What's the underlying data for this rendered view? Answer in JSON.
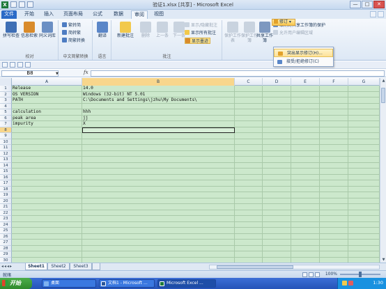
{
  "window": {
    "app_icon": "X",
    "title": "验证1.xlsx  [共享] - Microsoft Excel",
    "controls": [
      "—",
      "□",
      "✕"
    ]
  },
  "ribbon_tabs": [
    "文件",
    "开始",
    "插入",
    "页面布局",
    "公式",
    "数据",
    "审阅",
    "视图"
  ],
  "active_tab": "审阅",
  "ribbon": {
    "proofing": {
      "label": "校对",
      "buttons": [
        "拼写检查",
        "信息检索",
        "同义词库"
      ]
    },
    "chinese_conversion": {
      "label": "中文简繁转换",
      "buttons": [
        "繁转简",
        "简转繁",
        "简繁转换"
      ]
    },
    "language": {
      "label": "语言",
      "buttons": [
        "翻译"
      ]
    },
    "comments": {
      "label": "批注",
      "buttons": [
        "新建批注",
        "删除",
        "上一条",
        "下一条"
      ],
      "small_buttons": [
        "显示/隐藏批注",
        "显示所有批注",
        "显示墨迹"
      ]
    },
    "changes": {
      "buttons": [
        "保护工作表",
        "保护工作簿",
        "共享工作簿"
      ],
      "small_buttons": [
        "取消对共享工作簿的保护",
        "允许用户编辑区域"
      ],
      "revise_label": "修订"
    }
  },
  "revise_menu": {
    "items": [
      "突出显示修订(H)...",
      "接受/拒绝修订(C)"
    ],
    "hovered_index": 0
  },
  "formula_bar": {
    "name_box": "B8",
    "fx": "fx",
    "content": ""
  },
  "columns": [
    "A",
    "B",
    "C",
    "D",
    "E",
    "F",
    "G"
  ],
  "rows": [
    {
      "num": "1",
      "A": "Release",
      "B": "14.0"
    },
    {
      "num": "2",
      "A": "OS VERSION",
      "B": "Windows (32-bit) NT 5.01"
    },
    {
      "num": "3",
      "A": "PATH",
      "B": "C:\\Documents and Settings\\jzhu\\My Documents\\"
    },
    {
      "num": "4",
      "A": "",
      "B": ""
    },
    {
      "num": "5",
      "A": "calculation",
      "B": "hhh"
    },
    {
      "num": "6",
      "A": "peak area",
      "B": "jj"
    },
    {
      "num": "7",
      "A": "impurity",
      "B": "X"
    },
    {
      "num": "8",
      "A": "",
      "B": ""
    },
    {
      "num": "9",
      "A": "",
      "B": ""
    },
    {
      "num": "10",
      "A": "",
      "B": ""
    },
    {
      "num": "11",
      "A": "",
      "B": ""
    },
    {
      "num": "12",
      "A": "",
      "B": ""
    },
    {
      "num": "13",
      "A": "",
      "B": ""
    },
    {
      "num": "14",
      "A": "",
      "B": ""
    },
    {
      "num": "15",
      "A": "",
      "B": ""
    },
    {
      "num": "16",
      "A": "",
      "B": ""
    },
    {
      "num": "17",
      "A": "",
      "B": ""
    },
    {
      "num": "18",
      "A": "",
      "B": ""
    },
    {
      "num": "19",
      "A": "",
      "B": ""
    },
    {
      "num": "20",
      "A": "",
      "B": ""
    },
    {
      "num": "21",
      "A": "",
      "B": ""
    },
    {
      "num": "22",
      "A": "",
      "B": ""
    },
    {
      "num": "23",
      "A": "",
      "B": ""
    },
    {
      "num": "24",
      "A": "",
      "B": ""
    },
    {
      "num": "25",
      "A": "",
      "B": ""
    },
    {
      "num": "26",
      "A": "",
      "B": ""
    },
    {
      "num": "27",
      "A": "",
      "B": ""
    },
    {
      "num": "28",
      "A": "",
      "B": ""
    },
    {
      "num": "29",
      "A": "",
      "B": ""
    },
    {
      "num": "30",
      "A": "",
      "B": ""
    }
  ],
  "selected_cell": "B8",
  "sheets": [
    "Sheet1",
    "Sheet2",
    "Sheet3"
  ],
  "active_sheet": "Sheet1",
  "status": {
    "text": "就绪",
    "zoom": "100%"
  },
  "taskbar": {
    "start": "开始",
    "tasks": [
      "桌面",
      "文档1 - Microsoft ...",
      "Microsoft Excel ..."
    ],
    "active_task_index": 2,
    "clock": "1:30"
  },
  "colors": {
    "cell_fill": "#cce8cc",
    "ribbon_file_tab": "#2a6ac7",
    "menu_highlight": "#fde29a",
    "taskbar": "#2553b8",
    "start_button": "#3c9c39"
  }
}
